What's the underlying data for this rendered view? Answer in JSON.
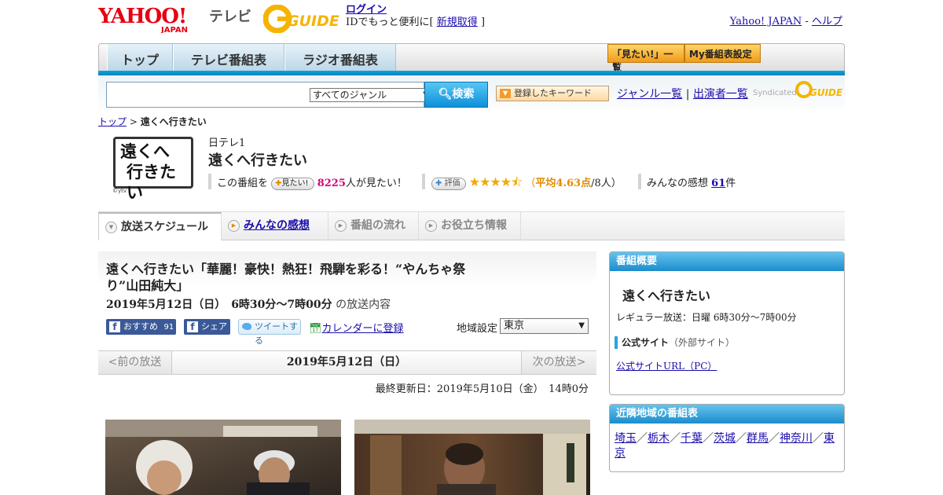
{
  "header": {
    "logo_main": "YAHOO!",
    "logo_sub": "JAPAN",
    "service_label": "テレビ",
    "gguide_logo": "G-GUIDE",
    "login_label": "ログイン",
    "login_desc": "IDでもっと便利に[",
    "register_label": "新規取得",
    "register_close": "]",
    "yahoo_japan_link": "Yahoo! JAPAN",
    "sep": " - ",
    "help_link": "ヘルプ"
  },
  "nav": {
    "tabs": [
      "トップ",
      "テレビ番組表",
      "ラジオ番組表"
    ],
    "want_list": "「見たい!」一覧",
    "my_schedule": "My番組表設定"
  },
  "search": {
    "genre_value": "すべてのジャンル",
    "search_button": "検索",
    "keyword_button": "登録したキーワード",
    "genre_list": "ジャンル一覧",
    "divider": "|",
    "performer_list": "出演者一覧",
    "syndicated": "Syndicated"
  },
  "breadcrumb": {
    "top": "トップ",
    "sep": " > ",
    "current": "遠くへ行きたい"
  },
  "program": {
    "logo_text_line1": "遠くへ",
    "logo_text_line2": "行きたい",
    "logo_credit": "©ytv",
    "channel": "日テレ1",
    "title": "遠くへ行きたい",
    "want_prefix": "この番組を",
    "want_btn": "見たい!",
    "want_count": "8225",
    "want_suffix": "人が見たい！",
    "rate_btn": "評価",
    "rating_stars": 4.63,
    "rating_open": "（",
    "rating_avg": "平均4.63点",
    "rating_count": "/8人）",
    "impressions_label": "みんなの感想",
    "impressions_count": "61",
    "impressions_unit": "件"
  },
  "tabs": [
    {
      "label": "放送スケジュール"
    },
    {
      "label": "みんなの感想"
    },
    {
      "label": "番組の流れ"
    },
    {
      "label": "お役立ち情報"
    }
  ],
  "episode": {
    "title": "遠くへ行きたい「華麗！豪快！熱狂！飛騨を彩る！“やんちゃ祭り”山田純大」",
    "datetime": "2019年5月12日（日）　6時30分～7時00分",
    "datetime_suffix": "の放送内容",
    "fb_recommend": "おすすめ",
    "fb_count": "91",
    "fb_share": "シェア",
    "tweet": "ツイートする",
    "calendar": "カレンダーに登録",
    "region_label": "地域設定",
    "region_value": "東京"
  },
  "pager": {
    "prev": "<前の放送",
    "current": "2019年5月12日（日）",
    "next": "次の放送>"
  },
  "last_updated": "最終更新日：2019年5月10日（金）　14時0分",
  "sidebar": {
    "overview": {
      "heading": "番組概要",
      "title": "遠くへ行きたい",
      "regular": "レギュラー放送：日曜 6時30分～7時00分",
      "official_label": "公式サイト",
      "official_note": "（外部サイト）",
      "official_link": "公式サイトURL（PC）"
    },
    "nearby": {
      "heading": "近隣地域の番組表",
      "regions": [
        "埼玉",
        "栃木",
        "千葉",
        "茨城",
        "群馬",
        "神奈川",
        "東京"
      ],
      "sep": "／"
    }
  }
}
